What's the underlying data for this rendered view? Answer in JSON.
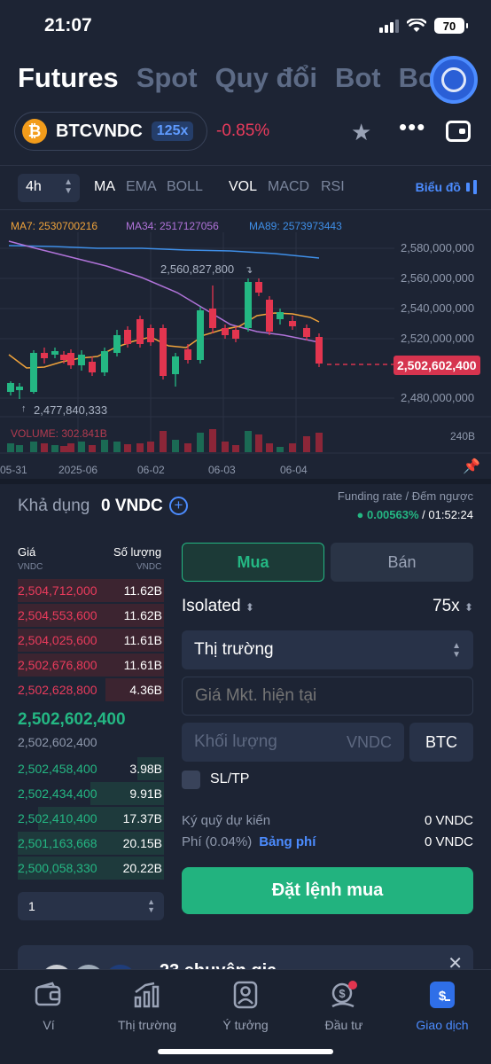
{
  "status": {
    "time": "21:07",
    "battery": "70"
  },
  "top_tabs": [
    "Futures",
    "Spot",
    "Quy đổi",
    "Bot",
    "Bo"
  ],
  "pair": {
    "symbol": "BTCVNDC",
    "leverage_badge": "125x",
    "change": "-0.85%",
    "coin_glyph": "₿"
  },
  "toolbar": {
    "interval": "4h",
    "indicators": [
      "MA",
      "EMA",
      "BOLL",
      "VOL",
      "MACD",
      "RSI"
    ],
    "chart_mode": "Biểu đồ"
  },
  "chart": {
    "ma7": "MA7: 2530700216",
    "ma34": "MA34: 2517127056",
    "ma89": "MA89: 2573973443",
    "price_axis": [
      "2,580,000,000",
      "2,560,000,000",
      "2,540,000,000",
      "2,520,000,000",
      "2,480,000,000"
    ],
    "current_price": "2,502,602,400",
    "high_annotation": "2,560,827,800",
    "low_annotation": "2,477,840,333",
    "volume_label": "VOLUME: 302.841B",
    "volume_axis": "240B",
    "dates": [
      "05-31",
      "2025-06",
      "06-02",
      "06-03",
      "06-04"
    ],
    "colors": {
      "up": "#24b783",
      "down": "#e3354f",
      "ma7": "#f0a33b",
      "ma34": "#b073d9",
      "ma89": "#3f8fe8"
    }
  },
  "available": {
    "label": "Khả dụng",
    "value": "0 VNDC"
  },
  "funding": {
    "label": "Funding rate / Đếm ngược",
    "rate": "0.00563%",
    "countdown": "/ 01:52:24"
  },
  "orderbook": {
    "price_header": "Giá",
    "qty_header": "Số lượng",
    "unit": "VNDC",
    "asks": [
      {
        "price": "2,504,712,000",
        "qty": "11.62B",
        "depth": 1.0
      },
      {
        "price": "2,504,553,600",
        "qty": "11.62B",
        "depth": 1.0
      },
      {
        "price": "2,504,025,600",
        "qty": "11.61B",
        "depth": 1.0
      },
      {
        "price": "2,502,676,800",
        "qty": "11.61B",
        "depth": 1.0
      },
      {
        "price": "2,502,628,800",
        "qty": "4.36B",
        "depth": 0.4
      }
    ],
    "mid_price": "2,502,602,400",
    "mark_price": "2,502,602,400",
    "bids": [
      {
        "price": "2,502,458,400",
        "qty": "3.98B",
        "depth": 0.18
      },
      {
        "price": "2,502,434,400",
        "qty": "9.91B",
        "depth": 0.5
      },
      {
        "price": "2,502,410,400",
        "qty": "17.37B",
        "depth": 0.86
      },
      {
        "price": "2,501,163,668",
        "qty": "20.15B",
        "depth": 1.0
      },
      {
        "price": "2,500,058,330",
        "qty": "20.22B",
        "depth": 1.0
      }
    ],
    "depth_select": "1"
  },
  "order_form": {
    "buy_label": "Mua",
    "sell_label": "Bán",
    "margin_mode": "Isolated",
    "leverage": "75x",
    "order_type": "Thị trường",
    "price_placeholder": "Giá Mkt. hiện tại",
    "qty_placeholder": "Khối lượng",
    "qty_unit": "VNDC",
    "qty_asset": "BTC",
    "sltp_label": "SL/TP",
    "margin_label": "Ký quỹ dự kiến",
    "margin_value": "0 VNDC",
    "fee_label": "Phí (0.04%)",
    "fee_link": "Bảng phí",
    "fee_value": "0 VNDC",
    "submit_label": "Đặt lệnh mua"
  },
  "expert_banner": {
    "title": "23 chuyên gia"
  },
  "bottom_nav": [
    {
      "label": "Ví",
      "icon": "wallet-icon"
    },
    {
      "label": "Thị trường",
      "icon": "market-chart-icon"
    },
    {
      "label": "Ý tưởng",
      "icon": "ideas-profile-icon"
    },
    {
      "label": "Đầu tư",
      "icon": "invest-icon"
    },
    {
      "label": "Giao dịch",
      "icon": "trade-icon"
    }
  ]
}
